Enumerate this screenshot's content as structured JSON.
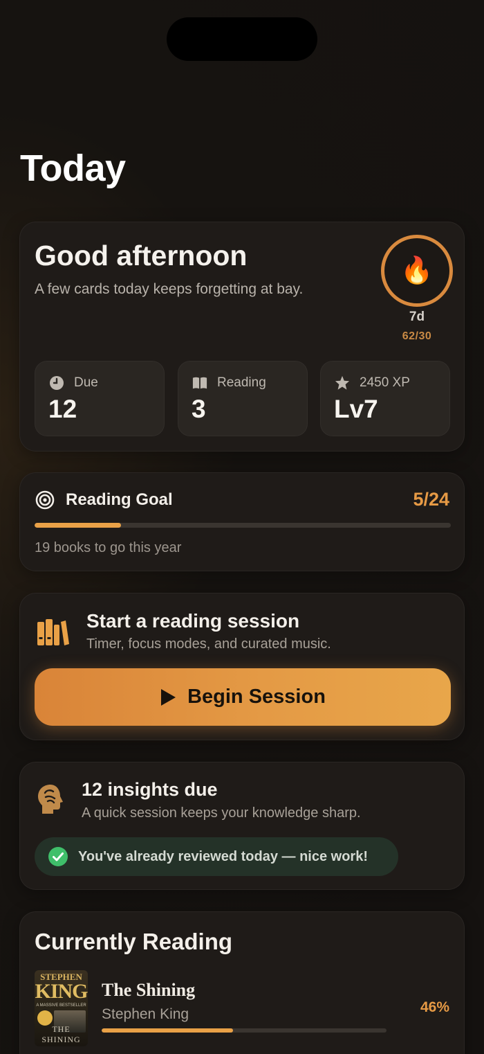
{
  "page": {
    "title": "Today"
  },
  "greeting": {
    "title": "Good afternoon",
    "subtitle": "A few cards today keeps forgetting at bay.",
    "streak": {
      "icon": "flame-icon",
      "emoji": "🔥",
      "days": "7d",
      "count": "62/30"
    }
  },
  "stats": [
    {
      "icon": "clock-icon",
      "label": "Due",
      "value": "12"
    },
    {
      "icon": "book-open-icon",
      "label": "Reading",
      "value": "3"
    },
    {
      "icon": "star-icon",
      "label": "2450 XP",
      "value": "Lv7"
    }
  ],
  "reading_goal": {
    "icon": "target-icon",
    "label": "Reading Goal",
    "count": "5/24",
    "progress": 0.2083,
    "note": "19 books to go this year"
  },
  "session": {
    "icon": "books-icon",
    "title": "Start a reading session",
    "subtitle": "Timer, focus modes, and curated music.",
    "button_label": "Begin Session",
    "button_icon": "play-icon"
  },
  "insights": {
    "icon": "brain-head-icon",
    "title": "12 insights due",
    "subtitle": "A quick session keeps your knowledge sharp.",
    "reviewed_icon": "check-circle-icon",
    "reviewed_text": "You've already reviewed today — nice work!"
  },
  "currently_reading": {
    "title": "Currently Reading",
    "books": [
      {
        "title": "The Shining",
        "author": "Stephen King",
        "progress_label": "46%",
        "progress": 0.46,
        "cover": {
          "author": "STEPHEN",
          "surname": "KING",
          "tagline": "A MASSIVE BESTSELLER",
          "book": "THE SHINING"
        }
      }
    ]
  },
  "colors": {
    "accent": "#e69a45",
    "background": "#151210",
    "card": "#1f1b18",
    "success": "#3fbf6a"
  }
}
